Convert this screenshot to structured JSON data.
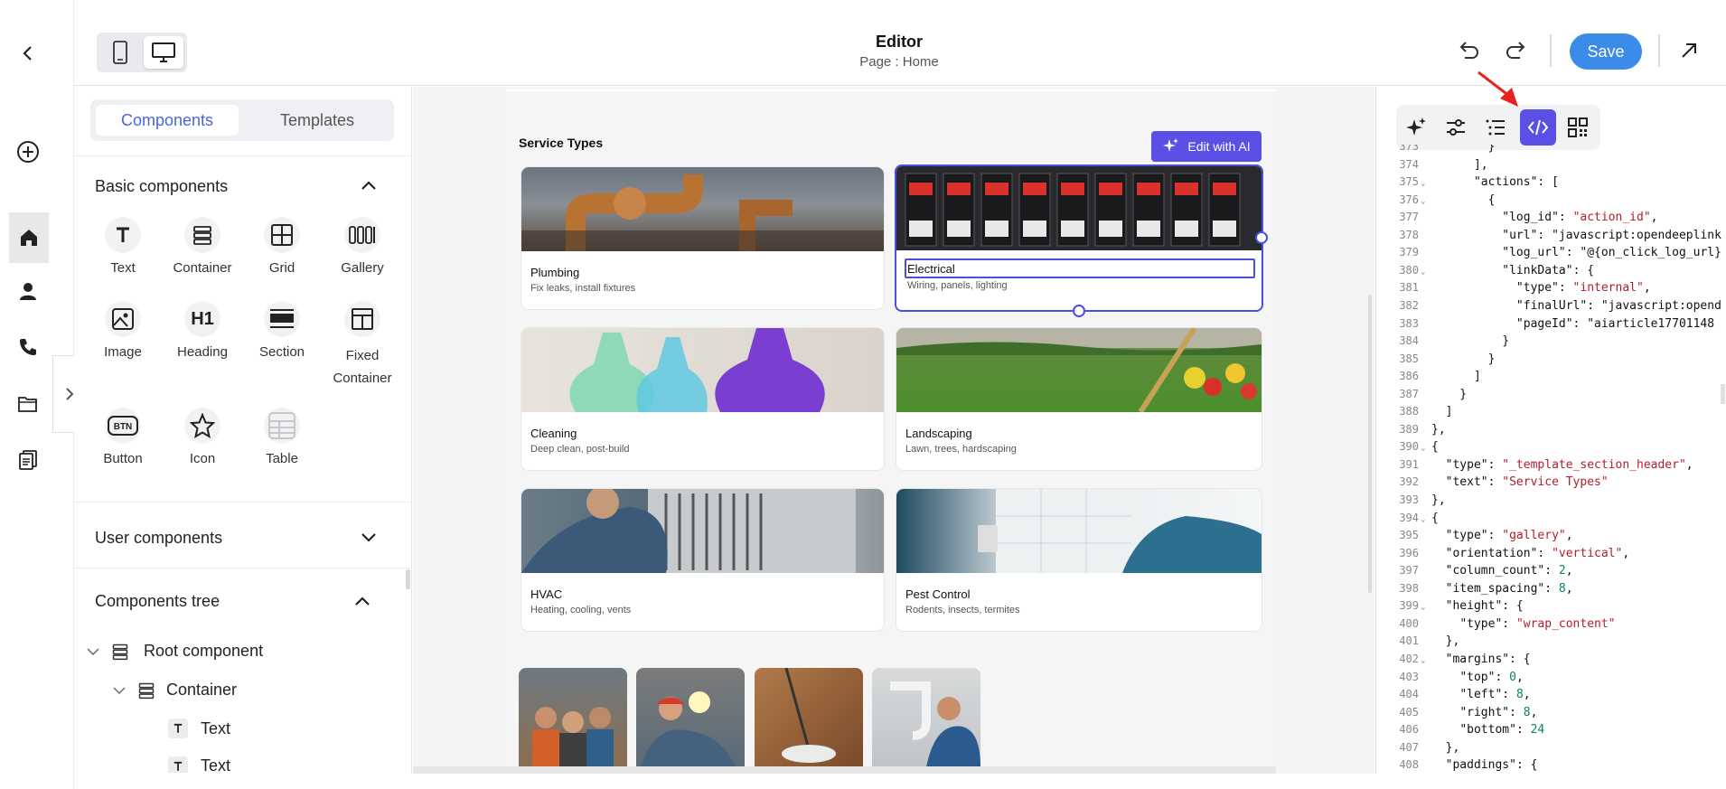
{
  "header": {
    "title": "Editor",
    "subtitle": "Page : Home",
    "save_label": "Save"
  },
  "left_panel": {
    "tabs": [
      "Components",
      "Templates"
    ],
    "active_tab": "Components",
    "basic_components_title": "Basic components",
    "basic_components": [
      "Text",
      "Container",
      "Grid",
      "Gallery",
      "Image",
      "Heading",
      "Section",
      "Fixed Container",
      "Button",
      "Icon",
      "Table"
    ],
    "user_components_title": "User components",
    "tree_title": "Components tree",
    "tree_items": [
      "Root component",
      "Container",
      "Text",
      "Text"
    ]
  },
  "canvas": {
    "section_title": "Service Types",
    "edit_ai_label": "Edit with AI",
    "cards": [
      {
        "title": "Plumbing",
        "sub": "Fix leaks, install fixtures"
      },
      {
        "title": "Electrical",
        "sub": "Wiring, panels, lighting"
      },
      {
        "title": "Cleaning",
        "sub": "Deep clean, post-build"
      },
      {
        "title": "Landscaping",
        "sub": "Lawn, trees, hardscaping"
      },
      {
        "title": "HVAC",
        "sub": "Heating, cooling, vents"
      },
      {
        "title": "Pest Control",
        "sub": "Rodents, insects, termites"
      }
    ]
  },
  "code_lines": [
    {
      "n": "373",
      "t": "        }"
    },
    {
      "n": "374",
      "t": "      ],"
    },
    {
      "n": "375",
      "t": "      \"actions\": ["
    },
    {
      "n": "376",
      "t": "        {"
    },
    {
      "n": "377",
      "t": "          \"log_id\": \"action_id\","
    },
    {
      "n": "378",
      "t": "          \"url\": \"javascript:opendeeplink"
    },
    {
      "n": "379",
      "t": "          \"log_url\": \"@{on_click_log_url}"
    },
    {
      "n": "380",
      "t": "          \"linkData\": {"
    },
    {
      "n": "381",
      "t": "            \"type\": \"internal\","
    },
    {
      "n": "382",
      "t": "            \"finalUrl\": \"javascript:opend"
    },
    {
      "n": "383",
      "t": "            \"pageId\": \"aiarticle17701148"
    },
    {
      "n": "384",
      "t": "          }"
    },
    {
      "n": "385",
      "t": "        }"
    },
    {
      "n": "386",
      "t": "      ]"
    },
    {
      "n": "387",
      "t": "    }"
    },
    {
      "n": "388",
      "t": "  ]"
    },
    {
      "n": "389",
      "t": "},"
    },
    {
      "n": "390",
      "t": "{"
    },
    {
      "n": "391",
      "t": "  \"type\": \"_template_section_header\","
    },
    {
      "n": "392",
      "t": "  \"text\": \"Service Types\""
    },
    {
      "n": "393",
      "t": "},"
    },
    {
      "n": "394",
      "t": "{"
    },
    {
      "n": "395",
      "t": "  \"type\": \"gallery\","
    },
    {
      "n": "396",
      "t": "  \"orientation\": \"vertical\","
    },
    {
      "n": "397",
      "t": "  \"column_count\": 2,"
    },
    {
      "n": "398",
      "t": "  \"item_spacing\": 8,"
    },
    {
      "n": "399",
      "t": "  \"height\": {"
    },
    {
      "n": "400",
      "t": "    \"type\": \"wrap_content\""
    },
    {
      "n": "401",
      "t": "  },"
    },
    {
      "n": "402",
      "t": "  \"margins\": {"
    },
    {
      "n": "403",
      "t": "    \"top\": 0,"
    },
    {
      "n": "404",
      "t": "    \"left\": 8,"
    },
    {
      "n": "405",
      "t": "    \"right\": 8,"
    },
    {
      "n": "406",
      "t": "    \"bottom\": 24"
    },
    {
      "n": "407",
      "t": "  },"
    },
    {
      "n": "408",
      "t": "  \"paddings\": {"
    }
  ],
  "colors": {
    "accent": "#4a63e7",
    "save": "#3b8be8",
    "code_string": "#b31d28",
    "code_number": "#098658"
  },
  "icons": [
    "back-icon",
    "add-icon",
    "home-icon",
    "user-icon",
    "phone-icon",
    "folder-icon",
    "pages-icon",
    "expand-icon",
    "mobile-icon",
    "desktop-icon",
    "undo-icon",
    "redo-icon",
    "external-link-icon",
    "sparkle-icon",
    "sliders-icon",
    "list-icon",
    "code-icon",
    "qr-icon"
  ]
}
